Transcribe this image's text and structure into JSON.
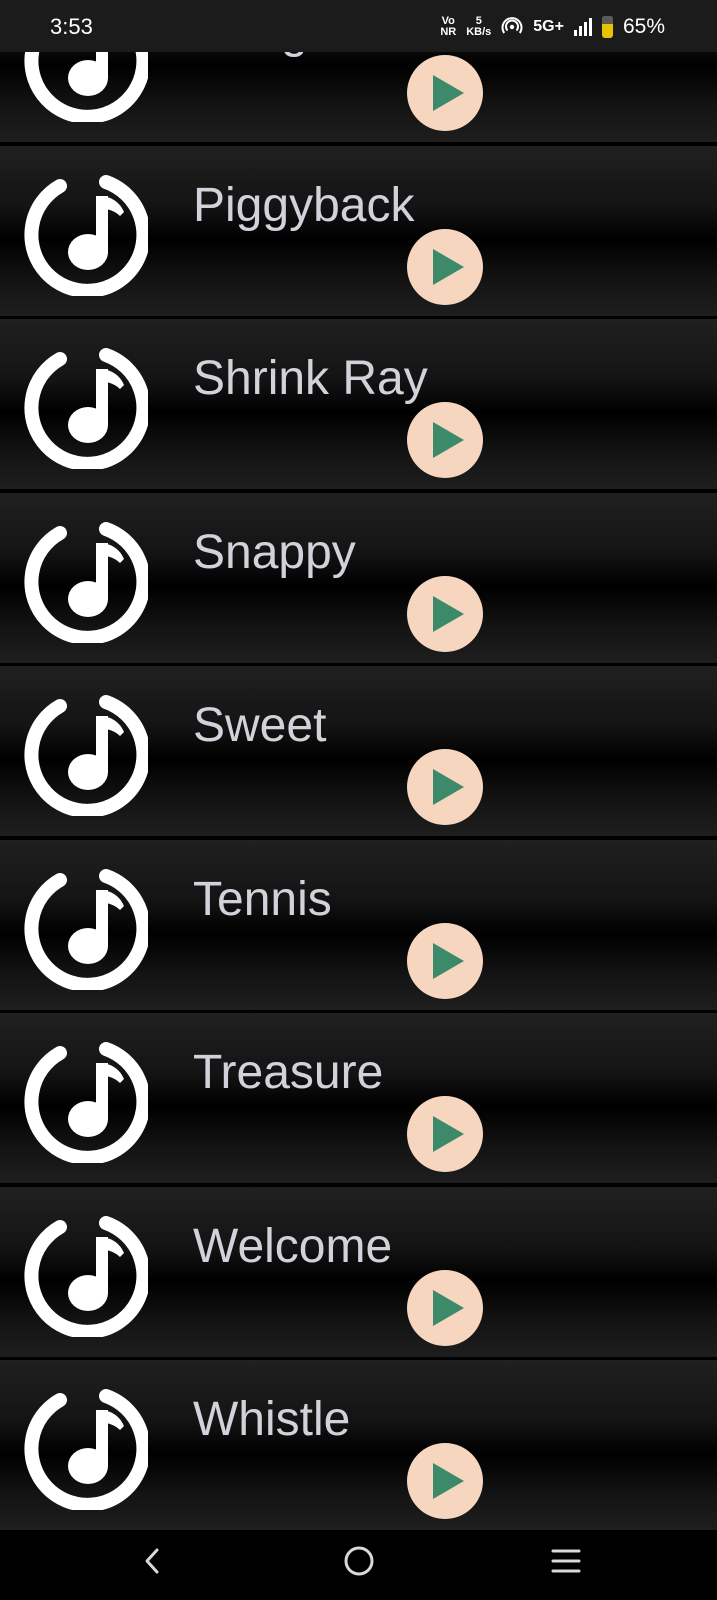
{
  "status_bar": {
    "time": "3:53",
    "volte_top": "Vo",
    "volte_bottom": "NR",
    "speed_value": "5",
    "speed_unit": "KB/s",
    "network": "5G+",
    "battery_percent": "65%"
  },
  "sounds": [
    {
      "title": "Nudge"
    },
    {
      "title": "Piggyback"
    },
    {
      "title": "Shrink Ray"
    },
    {
      "title": "Snappy"
    },
    {
      "title": "Sweet"
    },
    {
      "title": "Tennis"
    },
    {
      "title": "Treasure"
    },
    {
      "title": "Welcome"
    },
    {
      "title": "Whistle"
    }
  ],
  "colors": {
    "play_button_bg": "#f6d6bf",
    "play_icon": "#3c8a6a",
    "title_text": "#d4d1da",
    "icon_white": "#ffffff"
  },
  "icons": {
    "row_icon": "music-note-icon",
    "play_icon": "play-icon",
    "nav_back": "back-icon",
    "nav_home": "home-icon",
    "nav_menu": "menu-icon"
  }
}
